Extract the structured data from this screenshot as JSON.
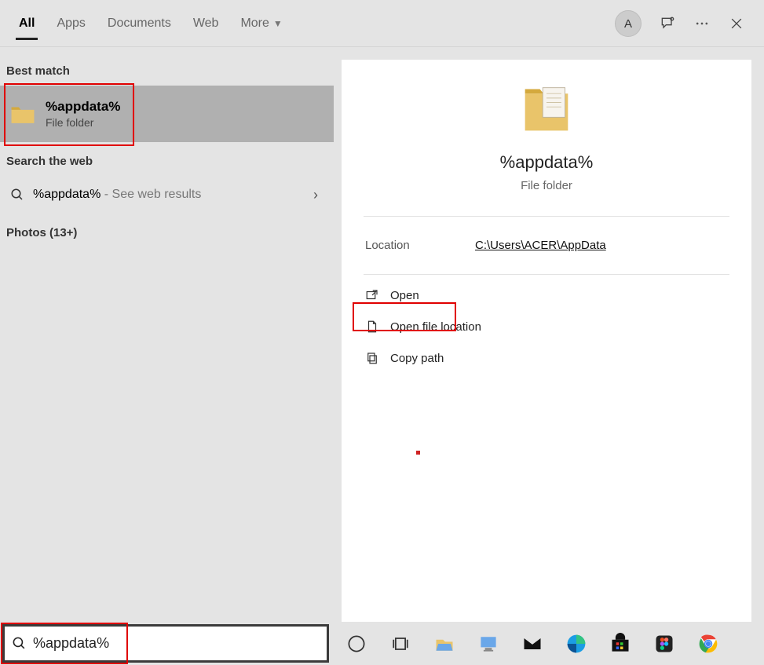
{
  "header": {
    "tabs": [
      "All",
      "Apps",
      "Documents",
      "Web",
      "More"
    ],
    "avatar_letter": "A"
  },
  "left": {
    "best_match_label": "Best match",
    "best_match": {
      "title": "%appdata%",
      "subtitle": "File folder"
    },
    "web_label": "Search the web",
    "web_result": {
      "query": "%appdata%",
      "suffix": " - See web results"
    },
    "photos_label": "Photos (13+)"
  },
  "preview": {
    "title": "%appdata%",
    "subtitle": "File folder",
    "location_label": "Location",
    "location_value": "C:\\Users\\ACER\\AppData",
    "actions": {
      "open": "Open",
      "open_location": "Open file location",
      "copy_path": "Copy path"
    }
  },
  "search": {
    "query": "%appdata%"
  }
}
